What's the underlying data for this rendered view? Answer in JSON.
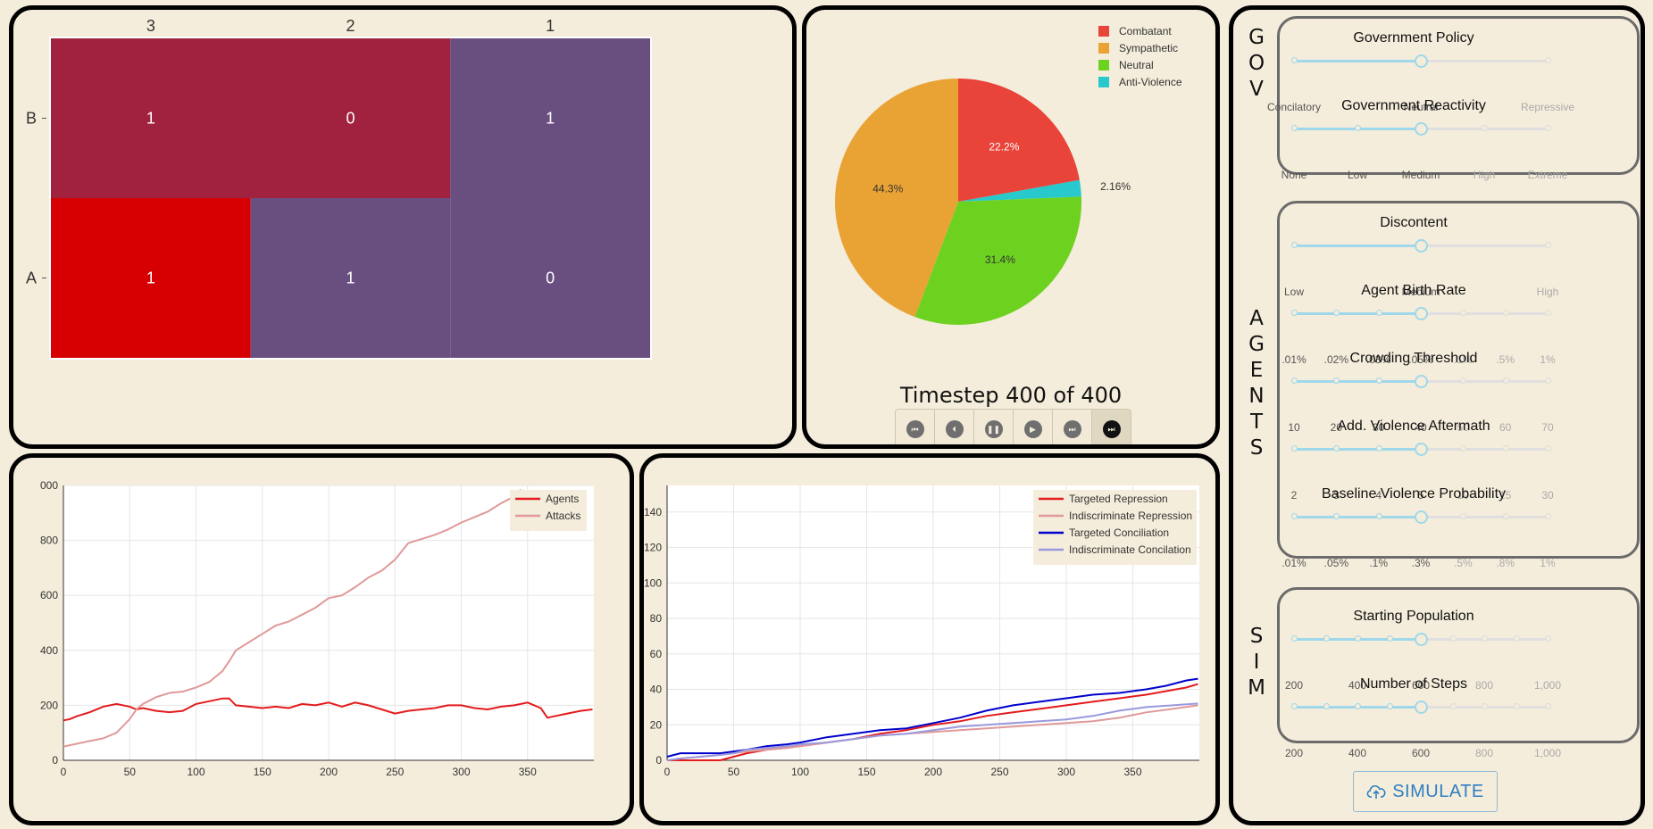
{
  "heatmap": {
    "columns": [
      "3",
      "2",
      "1"
    ],
    "rows": [
      "B",
      "A"
    ],
    "cells": [
      [
        1,
        0,
        1
      ],
      [
        1,
        1,
        0
      ]
    ],
    "colors": {
      "crimson": "#a0223e",
      "red": "#d60003",
      "purple": "#694f80"
    }
  },
  "pie_chart": {
    "legend": [
      "Combatant",
      "Sympathetic",
      "Neutral",
      "Anti-Violence"
    ],
    "colors": [
      "#e8443a",
      "#e9a335",
      "#6cd11f",
      "#28c9cc"
    ],
    "percents": [
      22.2,
      2.16,
      31.4,
      44.3
    ],
    "labels": [
      "22.2%",
      "2.16%",
      "31.4%",
      "44.3%"
    ]
  },
  "playback": {
    "timestep_label": "Timestep 400 of 400",
    "buttons": [
      "skip-to-start-icon",
      "step-back-icon",
      "pause-icon",
      "play-icon",
      "fast-forward-icon",
      "skip-to-end-icon"
    ]
  },
  "chart_data": [
    {
      "type": "line",
      "title": "",
      "x_ticks": [
        "0",
        "50",
        "100",
        "150",
        "200",
        "250",
        "300",
        "350"
      ],
      "y_ticks": [
        "0",
        "200",
        "400",
        "600",
        "800",
        "000"
      ],
      "xlim": [
        0,
        400
      ],
      "ylim": [
        0,
        1000
      ],
      "grid": true,
      "legend_position": "top-right",
      "series": [
        {
          "name": "Agents",
          "color": "#e41a1c",
          "x": [
            0,
            5,
            10,
            20,
            30,
            40,
            50,
            55,
            60,
            70,
            80,
            90,
            100,
            110,
            120,
            125,
            130,
            140,
            150,
            160,
            170,
            180,
            190,
            200,
            210,
            220,
            230,
            240,
            250,
            260,
            270,
            280,
            290,
            300,
            310,
            320,
            330,
            340,
            350,
            360,
            365,
            370,
            380,
            390,
            399
          ],
          "y": [
            145,
            150,
            160,
            175,
            195,
            205,
            195,
            185,
            190,
            180,
            175,
            180,
            205,
            215,
            225,
            225,
            200,
            195,
            190,
            195,
            190,
            205,
            200,
            210,
            195,
            210,
            200,
            185,
            170,
            180,
            185,
            190,
            200,
            200,
            190,
            185,
            195,
            200,
            210,
            190,
            155,
            160,
            170,
            180,
            185
          ]
        },
        {
          "name": "Attacks",
          "color": "#e0999a",
          "x": [
            0,
            10,
            20,
            30,
            40,
            50,
            55,
            60,
            70,
            80,
            90,
            100,
            110,
            120,
            125,
            130,
            140,
            150,
            160,
            170,
            180,
            190,
            200,
            210,
            220,
            230,
            240,
            250,
            260,
            270,
            280,
            290,
            300,
            310,
            320,
            330,
            340,
            345
          ],
          "y": [
            50,
            60,
            70,
            80,
            100,
            150,
            185,
            205,
            230,
            245,
            250,
            265,
            285,
            325,
            360,
            400,
            430,
            460,
            490,
            505,
            530,
            555,
            590,
            600,
            630,
            665,
            690,
            730,
            790,
            805,
            820,
            840,
            865,
            885,
            905,
            935,
            960,
            985
          ]
        }
      ]
    },
    {
      "type": "line",
      "title": "",
      "x_ticks": [
        "0",
        "50",
        "100",
        "150",
        "200",
        "250",
        "300",
        "350"
      ],
      "y_ticks": [
        "0",
        "20",
        "40",
        "60",
        "80",
        "100",
        "120",
        "140"
      ],
      "xlim": [
        0,
        400
      ],
      "ylim": [
        0,
        155
      ],
      "grid": true,
      "legend_position": "top-right",
      "series": [
        {
          "name": "Targeted Repression",
          "color": "#e41a1c",
          "x": [
            0,
            25,
            40,
            50,
            60,
            75,
            90,
            100,
            120,
            140,
            160,
            180,
            200,
            220,
            240,
            260,
            280,
            300,
            320,
            340,
            360,
            375,
            390,
            399
          ],
          "y": [
            0,
            0,
            0,
            2,
            4,
            6,
            7,
            8,
            10,
            12,
            15,
            17,
            20,
            22,
            25,
            27,
            29,
            31,
            33,
            35,
            37,
            39,
            41,
            43
          ]
        },
        {
          "name": "Indiscriminate Repression",
          "color": "#e0999a",
          "x": [
            0,
            10,
            25,
            40,
            50,
            60,
            75,
            90,
            100,
            120,
            140,
            160,
            180,
            200,
            220,
            240,
            260,
            280,
            300,
            320,
            340,
            360,
            380,
            399
          ],
          "y": [
            0,
            1,
            2,
            3,
            4,
            5,
            6,
            7,
            8,
            10,
            12,
            14,
            15,
            16,
            17,
            18,
            19,
            20,
            21,
            22,
            24,
            27,
            29,
            31
          ]
        },
        {
          "name": "Targeted Conciliation",
          "color": "#0000cc",
          "x": [
            0,
            10,
            25,
            40,
            50,
            60,
            75,
            90,
            100,
            120,
            140,
            160,
            180,
            200,
            220,
            240,
            260,
            280,
            300,
            320,
            340,
            360,
            375,
            390,
            399
          ],
          "y": [
            2,
            4,
            4,
            4,
            5,
            6,
            8,
            9,
            10,
            13,
            15,
            17,
            18,
            21,
            24,
            28,
            31,
            33,
            35,
            37,
            38,
            40,
            42,
            45,
            46
          ]
        },
        {
          "name": "Indiscriminate Concilation",
          "color": "#9999dd",
          "x": [
            0,
            10,
            25,
            40,
            50,
            60,
            75,
            90,
            100,
            120,
            140,
            160,
            180,
            200,
            220,
            240,
            260,
            280,
            300,
            320,
            340,
            360,
            380,
            399
          ],
          "y": [
            0,
            1,
            2,
            3,
            4,
            6,
            7,
            8,
            9,
            10,
            12,
            14,
            15,
            17,
            19,
            20,
            21,
            22,
            23,
            25,
            28,
            30,
            31,
            32
          ]
        }
      ]
    }
  ],
  "controls": {
    "section_labels": {
      "gov": "GOV",
      "agents": "AGENTS",
      "sim": "SIM"
    },
    "sliders": [
      {
        "title": "Government Policy",
        "ticks": [
          "Concilatory",
          "Neutral",
          "Repressive"
        ],
        "selected": 1
      },
      {
        "title": "Government Reactivity",
        "ticks": [
          "None",
          "Low",
          "Medium",
          "High",
          "Extreme"
        ],
        "selected": 2
      },
      {
        "title": "Discontent",
        "ticks": [
          "Low",
          "Medium",
          "High"
        ],
        "selected": 1
      },
      {
        "title": "Agent Birth Rate",
        "ticks": [
          ".01%",
          ".02%",
          ".03%",
          ".05%",
          ".1%",
          ".5%",
          "1%"
        ],
        "selected": 3
      },
      {
        "title": "Crowding Threshold",
        "ticks": [
          "10",
          "20",
          "30",
          "40",
          "50",
          "60",
          "70"
        ],
        "selected": 3
      },
      {
        "title": "Add. Violence Aftermath",
        "ticks": [
          "2",
          "3",
          "4",
          "5",
          "10",
          "15",
          "30"
        ],
        "selected": 3
      },
      {
        "title": "Baseline Violence Probability",
        "ticks": [
          ".01%",
          ".05%",
          ".1%",
          ".3%",
          ".5%",
          ".8%",
          "1%"
        ],
        "selected": 3
      },
      {
        "title": "Starting Population",
        "ticks": [
          "200",
          "",
          "400",
          "",
          "600",
          "",
          "800",
          "",
          "1,000"
        ],
        "selected": 4
      },
      {
        "title": "Number of Steps",
        "ticks": [
          "200",
          "",
          "400",
          "",
          "600",
          "",
          "800",
          "",
          "1,000"
        ],
        "selected": 4
      }
    ],
    "simulate_label": "SIMULATE",
    "simulate_icon": "cloud-upload-icon",
    "accent_color": "#2f7fc1"
  }
}
